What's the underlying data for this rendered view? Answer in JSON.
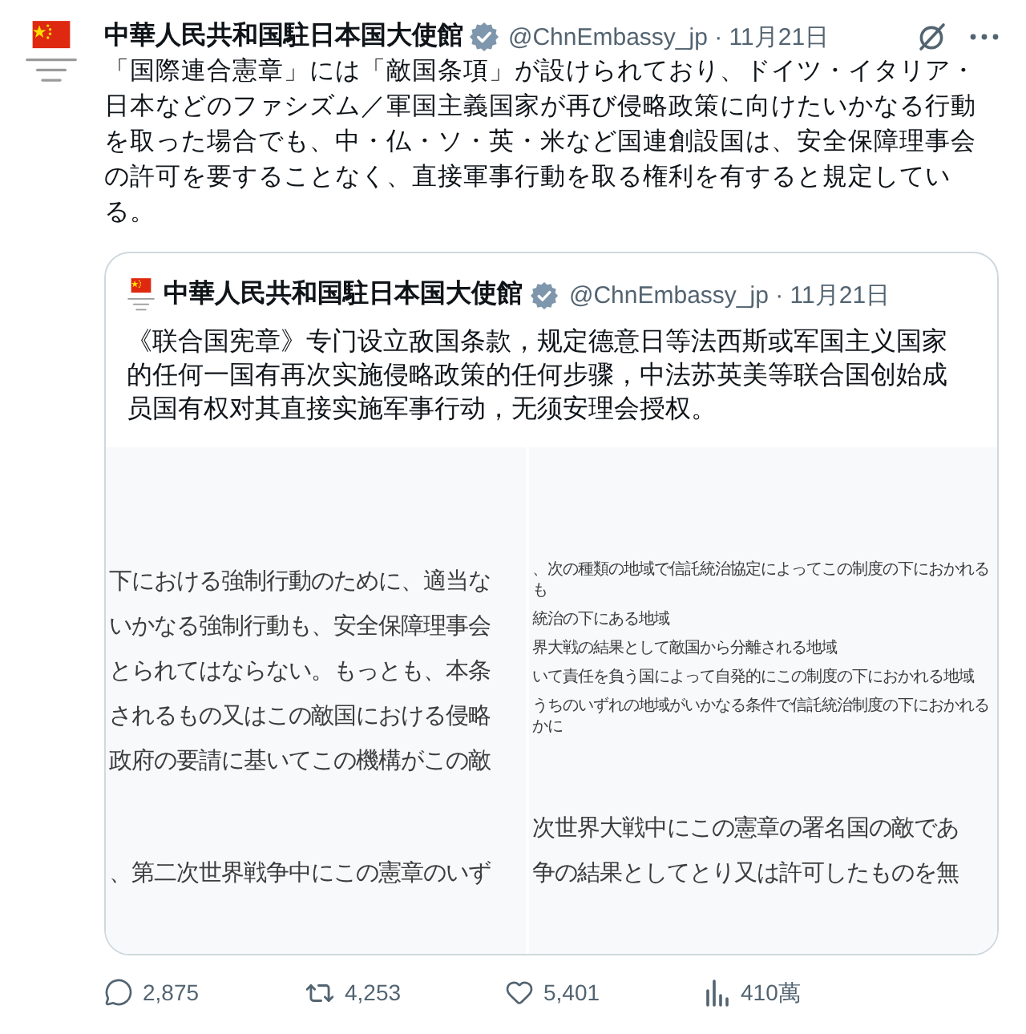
{
  "tweet": {
    "author": {
      "name": "中華人民共和国駐日本国大使館",
      "verified": true,
      "byline": "@ChnEmbassy_jp · 11月21日"
    },
    "text": "「国際連合憲章」には「敵国条項」が設けられており、ドイツ・イタリア・日本などのファシズム／軍国主義国家が再び侵略政策に向けたいかなる行動を取った場合でも、中・仏・ソ・英・米など国連創設国は、安全保障理事会の許可を要することなく、直接軍事行動を取る権利を有すると規定している。",
    "quoted_tweet": {
      "author": {
        "name": "中華人民共和国駐日本国大使館",
        "verified": true,
        "byline": "@ChnEmbassy_jp · 11月21日"
      },
      "text": "《联合国宪章》专门设立敌国条款，规定德意日等法西斯或军国主义国家的任何一国有再次实施侵略政策的任何步骤，中法苏英美等联合国创始成员国有权对其直接实施军事行动，无须安理会授权。",
      "images": [
        {
          "blocks": [
            {
              "kind": "large",
              "lines": [
                "下における強制行動のために、適当な",
                "いかなる強制行動も、安全保障理事会",
                "とられてはならない。もっとも、本条",
                "されるもの又はこの敵国における侵略",
                "政府の要請に基いてこの機構がこの敵"
              ]
            },
            {
              "kind": "large",
              "lines": [
                "、第二次世界戦争中にこの憲章のいず"
              ]
            }
          ]
        },
        {
          "blocks": [
            {
              "kind": "small",
              "lines": [
                "、次の種類の地域で信託統治協定によってこの制度の下におかれるも",
                "統治の下にある地域",
                "界大戦の結果として敵国から分離される地域",
                "いて責任を負う国によって自発的にこの制度の下におかれる地域",
                "うちのいずれの地域がいかなる条件で信託統治制度の下におかれるかに"
              ]
            },
            {
              "kind": "large",
              "lines": [
                "次世界大戦中にこの憲章の署名国の敵であ",
                "争の結果としてとり又は許可したものを無"
              ]
            }
          ]
        }
      ]
    },
    "actions": [
      {
        "kind": "reply",
        "count": "2,875"
      },
      {
        "kind": "repost",
        "count": "4,253"
      },
      {
        "kind": "like",
        "count": "5,401"
      },
      {
        "kind": "views",
        "count": "410萬"
      }
    ]
  }
}
